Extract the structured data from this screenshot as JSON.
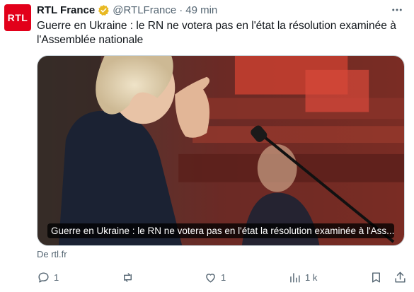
{
  "tweet": {
    "avatar_text": "RTL",
    "author_name": "RTL France",
    "handle": "@RTLFrance",
    "separator": "·",
    "time": "49 min",
    "text": "Guerre en Ukraine : le RN ne votera pas en l'état la résolution examinée à l'Assemblée nationale",
    "card_caption": "Guerre en Ukraine : le RN ne votera pas en l'état la résolution examinée à l'Ass...",
    "source": "De rtl.fr"
  },
  "actions": {
    "replies": "1",
    "reposts": "",
    "likes": "1",
    "views": "1 k"
  },
  "colors": {
    "brand": "#e2001a",
    "verified": "#e8b923",
    "muted": "#536471"
  },
  "icons": [
    "verified-badge-icon",
    "more-icon",
    "reply-icon",
    "repost-icon",
    "like-icon",
    "views-icon",
    "bookmark-icon",
    "share-icon"
  ]
}
